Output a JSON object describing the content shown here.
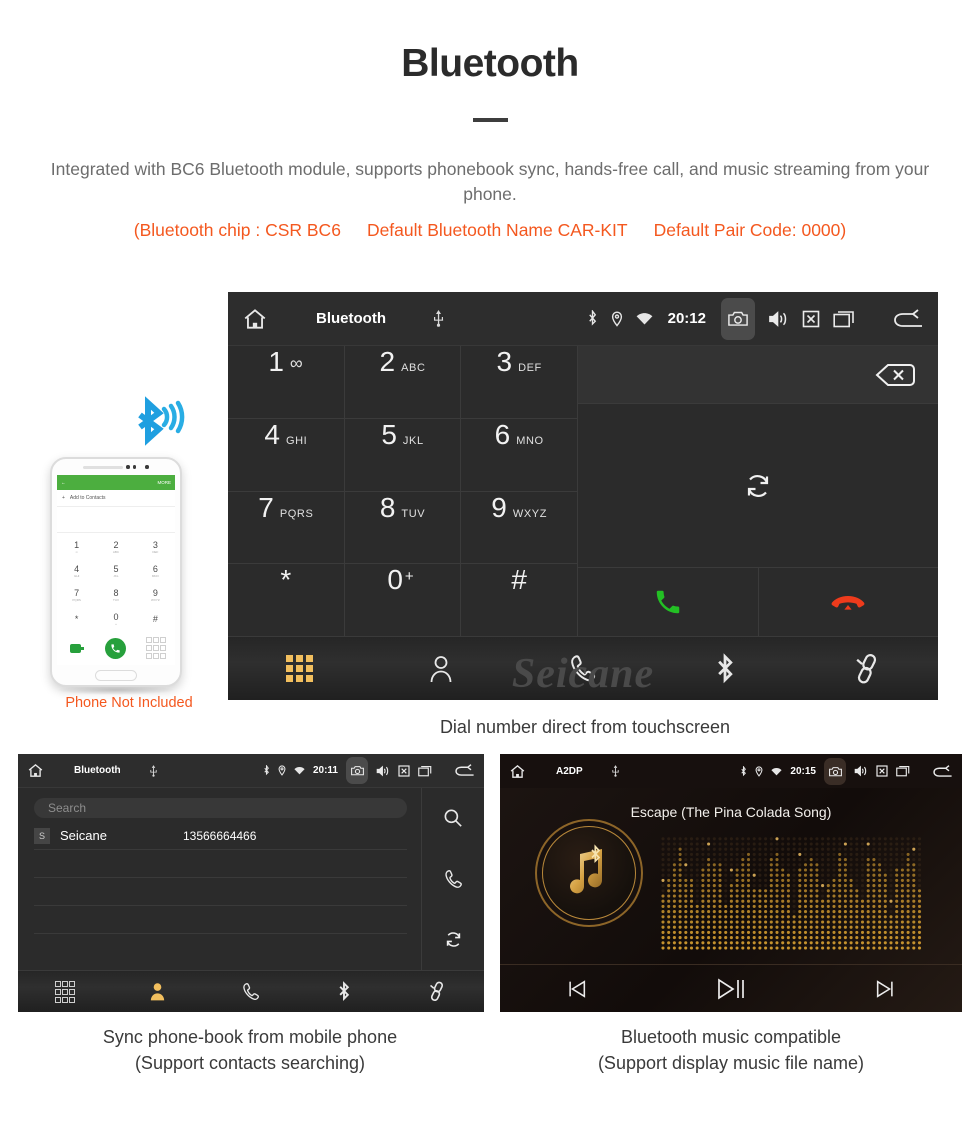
{
  "header": {
    "title": "Bluetooth",
    "description": "Integrated with BC6 Bluetooth module, supports phonebook sync, hands-free call, and music streaming from your phone.",
    "spec_chip": "(Bluetooth chip : CSR BC6",
    "spec_name": "Default Bluetooth Name CAR-KIT",
    "spec_pair": "Default Pair Code: 0000)",
    "accent_color": "#f4581f",
    "title_color": "#2b2b2b",
    "description_color": "#6d6d6d"
  },
  "main_screen": {
    "statusbar": {
      "home_icon": "home-icon",
      "title": "Bluetooth",
      "usb_icon": "usb-icon",
      "bluetooth_icon": "bluetooth-icon",
      "location_icon": "location-pin-icon",
      "wifi_icon": "wifi-icon",
      "time": "20:12",
      "camera_icon": "camera-icon",
      "volume_icon": "volume-icon",
      "mute_icon": "mute-x-icon",
      "recents_icon": "recent-apps-icon",
      "back_icon": "back-arrow-icon"
    },
    "keypad": [
      {
        "digit": "1",
        "sub": "∞",
        "voicemail": true
      },
      {
        "digit": "2",
        "sub": "ABC"
      },
      {
        "digit": "3",
        "sub": "DEF"
      },
      {
        "digit": "4",
        "sub": "GHI"
      },
      {
        "digit": "5",
        "sub": "JKL"
      },
      {
        "digit": "6",
        "sub": "MNO"
      },
      {
        "digit": "7",
        "sub": "PQRS"
      },
      {
        "digit": "8",
        "sub": "TUV"
      },
      {
        "digit": "9",
        "sub": "WXYZ"
      },
      {
        "digit": "*",
        "sub": ""
      },
      {
        "digit": "0",
        "sub": "+"
      },
      {
        "digit": "#",
        "sub": ""
      }
    ],
    "number_value": "",
    "backspace_icon": "backspace-icon",
    "sync_icon": "sync-icon",
    "answer_icon": "answer-call-icon",
    "hangup_icon": "hangup-call-icon",
    "answer_color": "#23c024",
    "hangup_color": "#ee3b1c",
    "navbar": [
      {
        "name": "dialpad",
        "icon": "dialpad-icon",
        "active": true
      },
      {
        "name": "contacts",
        "icon": "person-icon",
        "active": false
      },
      {
        "name": "call-log",
        "icon": "phone-icon",
        "active": false
      },
      {
        "name": "bluetooth",
        "icon": "bluetooth-icon",
        "active": false
      },
      {
        "name": "pair",
        "icon": "link-icon",
        "active": false
      }
    ],
    "watermark": "Seicane",
    "active_color": "#f2bf5e"
  },
  "phone_mockup": {
    "header_back": "←",
    "header_more": "MORE",
    "add_contacts": "Add to Contacts",
    "add_plus": "+",
    "keys": [
      {
        "digit": "1",
        "sub": "∞"
      },
      {
        "digit": "2",
        "sub": "ABC"
      },
      {
        "digit": "3",
        "sub": "DEF"
      },
      {
        "digit": "4",
        "sub": "GHI"
      },
      {
        "digit": "5",
        "sub": "JKL"
      },
      {
        "digit": "6",
        "sub": "MNO"
      },
      {
        "digit": "7",
        "sub": "PQRS"
      },
      {
        "digit": "8",
        "sub": "TUV"
      },
      {
        "digit": "9",
        "sub": "WXYZ"
      },
      {
        "digit": "*",
        "sub": ""
      },
      {
        "digit": "0",
        "sub": "+"
      },
      {
        "digit": "#",
        "sub": ""
      }
    ],
    "note": "Phone Not Included",
    "note_color": "#f4581f",
    "bluetooth_icon": "bluetooth-signal-icon"
  },
  "captions": {
    "main": "Dial number direct from touchscreen",
    "left_line1": "Sync phone-book from mobile phone",
    "left_line2": "(Support contacts searching)",
    "right_line1": "Bluetooth music compatible",
    "right_line2": "(Support display music file name)"
  },
  "phonebook_screen": {
    "statusbar": {
      "title": "Bluetooth",
      "time": "20:11"
    },
    "search_placeholder": "Search",
    "search_value": "",
    "columns": [
      "name",
      "number"
    ],
    "contacts": [
      {
        "badge": "S",
        "name": "Seicane",
        "number": "13566664466"
      }
    ],
    "empty_rows": 3,
    "side_buttons": [
      {
        "name": "search",
        "icon": "search-icon"
      },
      {
        "name": "call",
        "icon": "phone-icon"
      },
      {
        "name": "sync",
        "icon": "sync-icon"
      }
    ],
    "navbar": [
      {
        "name": "dialpad",
        "icon": "dialpad-icon",
        "active": false
      },
      {
        "name": "contacts",
        "icon": "person-icon",
        "active": true
      },
      {
        "name": "call-log",
        "icon": "phone-icon",
        "active": false
      },
      {
        "name": "bluetooth",
        "icon": "bluetooth-icon",
        "active": false
      },
      {
        "name": "pair",
        "icon": "link-icon",
        "active": false
      }
    ]
  },
  "music_screen": {
    "statusbar": {
      "title": "A2DP",
      "time": "20:15"
    },
    "song_title": "Escape (The Pina Colada Song)",
    "album_art_icon": "music-note-bluetooth-icon",
    "equalizer": "dot-matrix-equalizer",
    "controls": [
      {
        "name": "previous",
        "icon": "previous-track-icon"
      },
      {
        "name": "play-pause",
        "icon": "play-pause-icon"
      },
      {
        "name": "next",
        "icon": "next-track-icon"
      }
    ],
    "gold_color": "#d8a44a"
  }
}
